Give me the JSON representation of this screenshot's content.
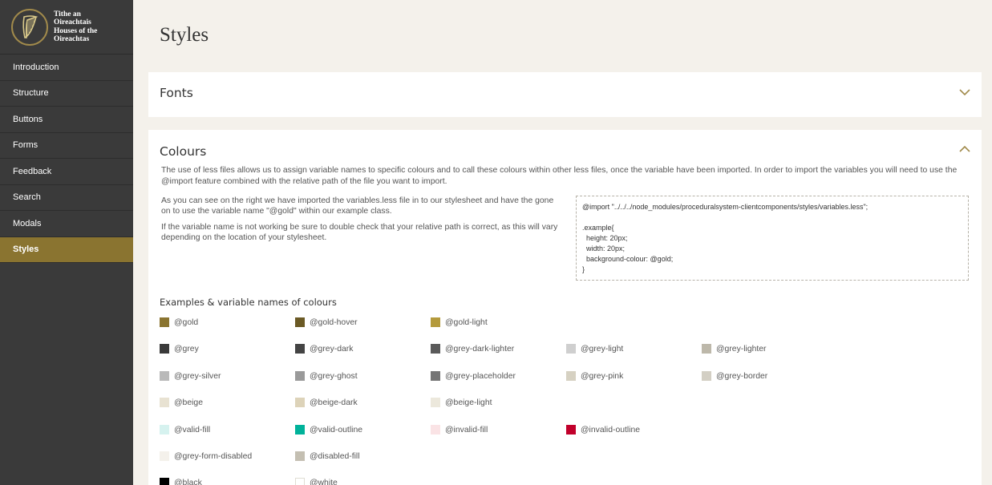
{
  "logo": {
    "line1": "Tithe an",
    "line2": "Oireachtais",
    "line3": "Houses of the",
    "line4": "Oireachtas",
    "icon": "harp-icon"
  },
  "nav": {
    "items": [
      {
        "label": "Introduction"
      },
      {
        "label": "Structure"
      },
      {
        "label": "Buttons"
      },
      {
        "label": "Forms"
      },
      {
        "label": "Feedback"
      },
      {
        "label": "Search"
      },
      {
        "label": "Modals"
      },
      {
        "label": "Styles",
        "active": true
      }
    ]
  },
  "page": {
    "title": "Styles"
  },
  "fonts_panel": {
    "title": "Fonts",
    "icon": "chevron-down-icon"
  },
  "colours_panel": {
    "title": "Colours",
    "icon": "chevron-up-icon",
    "intro": "The use of less files allows us to assign variable names to specific colours and to call these colours within other less files, once the variable have been imported. In order to import the variables you will need to use the @import feature combined with the relative path of the file you want to import.",
    "para1": "As you can see on the right we have imported the variables.less file in to our stylesheet and have the gone on to use the variable name \"@gold\" within our example class.",
    "para2": "If the variable name is not working be sure to double check that your relative path is correct, as this will vary depending on the location of your stylesheet.",
    "code": "@import \"../../../node_modules/proceduralsystem-clientcomponents/styles/variables.less\";\n\n.example{\n  height: 20px;\n  width: 20px;\n  background-colour: @gold;\n}",
    "examples_title": "Examples & variable names of colours",
    "swatches": [
      {
        "name": "@gold",
        "color": "#8a7430"
      },
      {
        "name": "@gold-hover",
        "color": "#6b5a25"
      },
      {
        "name": "@gold-light",
        "color": "#b49a3c"
      },
      {
        "name": "@grey",
        "color": "#3a3a3a"
      },
      {
        "name": "@grey-dark",
        "color": "#444444"
      },
      {
        "name": "@grey-dark-lighter",
        "color": "#5a5a5a"
      },
      {
        "name": "@grey-light",
        "color": "#cfcfcf"
      },
      {
        "name": "@grey-lighter",
        "color": "#bdb8aa"
      },
      {
        "name": "@grey-silver",
        "color": "#b9b9b9"
      },
      {
        "name": "@grey-ghost",
        "color": "#9a9a9a"
      },
      {
        "name": "@grey-placeholder",
        "color": "#757575"
      },
      {
        "name": "@grey-pink",
        "color": "#d6d1c2"
      },
      {
        "name": "@grey-border",
        "color": "#d3cfc4"
      },
      {
        "name": "@beige",
        "color": "#e8e2d2"
      },
      {
        "name": "@beige-dark",
        "color": "#ddd3b9"
      },
      {
        "name": "@beige-light",
        "color": "#ece8dc"
      },
      {
        "name": "@valid-fill",
        "color": "#d6f2ef"
      },
      {
        "name": "@valid-outline",
        "color": "#00b29a"
      },
      {
        "name": "@invalid-fill",
        "color": "#fae3e5"
      },
      {
        "name": "@invalid-outline",
        "color": "#c1002b"
      },
      {
        "name": "@grey-form-disabled",
        "color": "#f4f1eb"
      },
      {
        "name": "@disabled-fill",
        "color": "#c4bfb2"
      },
      {
        "name": "@black",
        "color": "#000000"
      },
      {
        "name": "@white",
        "color": "#ffffff"
      }
    ]
  }
}
